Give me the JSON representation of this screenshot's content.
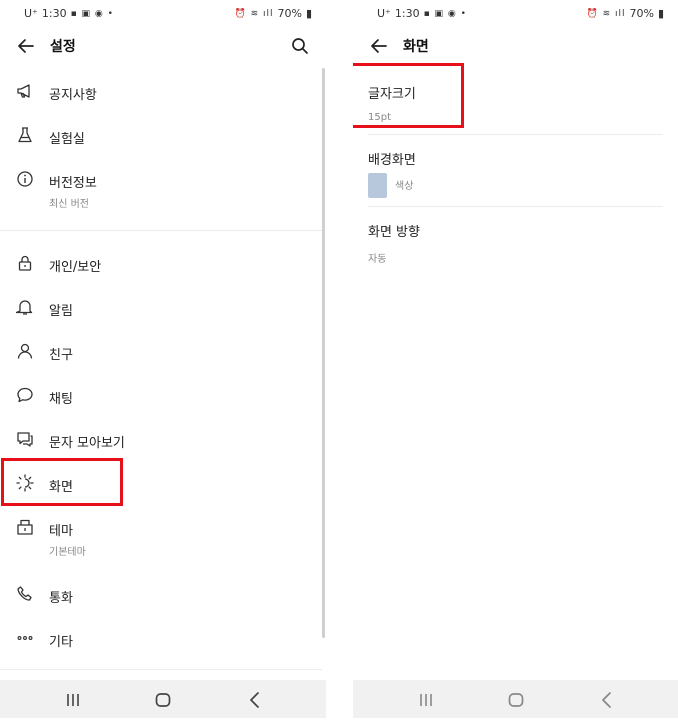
{
  "status_bar": {
    "carrier": "U⁺",
    "time": "1:30",
    "battery": "70%"
  },
  "left": {
    "header": {
      "title": "설정"
    },
    "items": [
      {
        "label": "공지사항",
        "icon": "megaphone-icon"
      },
      {
        "label": "실험실",
        "icon": "flask-icon"
      },
      {
        "label": "버전정보",
        "sub": "최신 버전",
        "icon": "info-icon"
      },
      {
        "label": "개인/보안",
        "icon": "lock-icon"
      },
      {
        "label": "알림",
        "icon": "bell-icon"
      },
      {
        "label": "친구",
        "icon": "person-icon"
      },
      {
        "label": "채팅",
        "icon": "chat-bubble-icon"
      },
      {
        "label": "문자 모아보기",
        "icon": "message-icon"
      },
      {
        "label": "화면",
        "icon": "sun-icon"
      },
      {
        "label": "테마",
        "sub": "기본테마",
        "icon": "theme-icon"
      },
      {
        "label": "통화",
        "icon": "phone-icon"
      },
      {
        "label": "기타",
        "icon": "more-icon"
      }
    ]
  },
  "right": {
    "header": {
      "title": "화면"
    },
    "font_size": {
      "label": "글자크기",
      "value": "15pt"
    },
    "background": {
      "label": "배경화면",
      "value": "색상",
      "swatch_color": "#b8c8dc"
    },
    "orientation": {
      "label": "화면 방향",
      "value": "자동"
    }
  },
  "colors": {
    "highlight": "#e5101a",
    "accent_text": "#222222",
    "secondary_text": "#888888"
  }
}
